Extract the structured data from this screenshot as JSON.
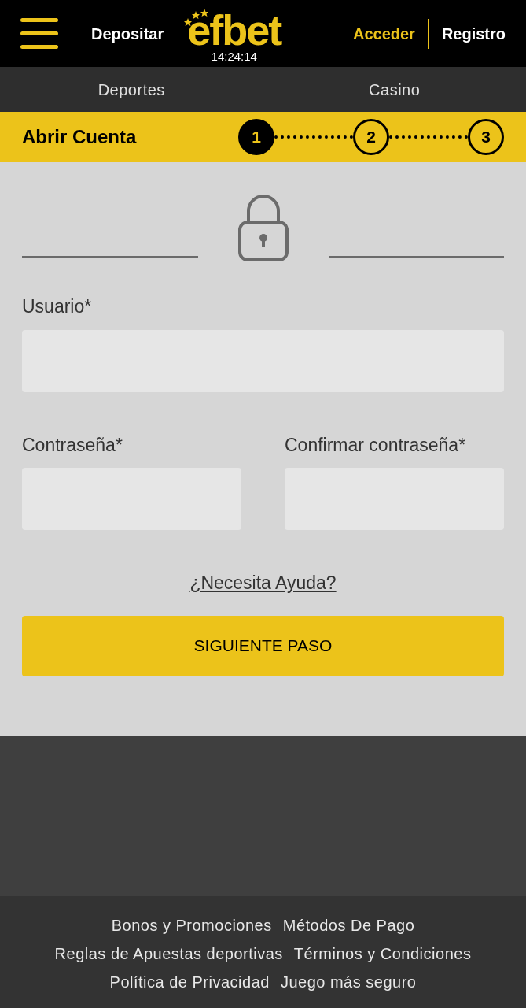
{
  "header": {
    "deposit": "Depositar",
    "logo": "efbet",
    "time": "14:24:14",
    "login": "Acceder",
    "register": "Registro"
  },
  "nav": [
    "Deportes",
    "Casino"
  ],
  "steps_bar": {
    "title": "Abrir Cuenta",
    "steps": [
      {
        "label": "1",
        "selected": true
      },
      {
        "label": "2",
        "selected": false
      },
      {
        "label": "3",
        "selected": false
      }
    ]
  },
  "form": {
    "username_label": "Usuario*",
    "password_label": "Contraseña*",
    "confirm_label": "Confirmar contraseña*",
    "help_link": "¿Necesita Ayuda?",
    "next_button": "SIGUIENTE PASO"
  },
  "footer_links": [
    [
      "Bonos y Promociones",
      "Métodos De Pago"
    ],
    [
      "Reglas de Apuestas deportivas",
      "Términos y Condiciones"
    ],
    [
      "Política de Privacidad",
      "Juego más seguro"
    ]
  ]
}
